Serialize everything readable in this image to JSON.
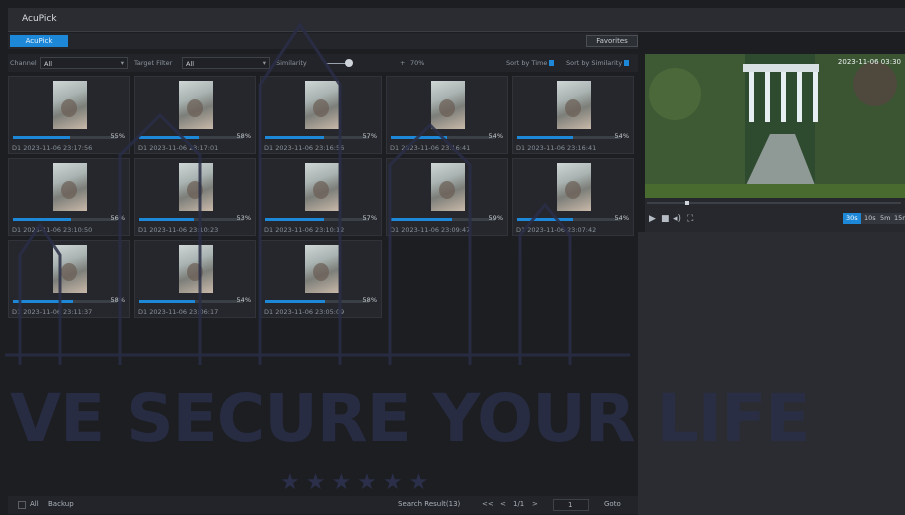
{
  "window": {
    "title": "AcuPick"
  },
  "tabs": {
    "active": "AcuPick",
    "favorites": "Favorites"
  },
  "filters": {
    "channel_label": "Channel",
    "channel_value": "All",
    "target_label": "Target Filter",
    "target_value": "All",
    "similarity_label": "Similarity",
    "threshold_label": "70%",
    "sort_time": "Sort by Time",
    "sort_similarity": "Sort by Similarity"
  },
  "results": [
    {
      "pct": "55%",
      "fill": 0.55,
      "stamp": "D1 2023-11-06 23:17:56"
    },
    {
      "pct": "58%",
      "fill": 0.58,
      "stamp": "D1 2023-11-06 23:17:01"
    },
    {
      "pct": "57%",
      "fill": 0.57,
      "stamp": "D1 2023-11-06 23:16:56"
    },
    {
      "pct": "54%",
      "fill": 0.54,
      "stamp": "D1 2023-11-06 23:16:41"
    },
    {
      "pct": "54%",
      "fill": 0.54,
      "stamp": "D1 2023-11-06 23:16:41"
    },
    {
      "pct": "56%",
      "fill": 0.56,
      "stamp": "D1 2023-11-06 23:10:50"
    },
    {
      "pct": "53%",
      "fill": 0.53,
      "stamp": "D1 2023-11-06 23:10:23"
    },
    {
      "pct": "57%",
      "fill": 0.57,
      "stamp": "D1 2023-11-06 23:10:12"
    },
    {
      "pct": "59%",
      "fill": 0.59,
      "stamp": "D1 2023-11-06 23:09:47"
    },
    {
      "pct": "54%",
      "fill": 0.54,
      "stamp": "D1 2023-11-06 23:07:42"
    },
    {
      "pct": "58%",
      "fill": 0.58,
      "stamp": "D1 2023-11-06 23:11:37"
    },
    {
      "pct": "54%",
      "fill": 0.54,
      "stamp": "D1 2023-11-06 23:06:17"
    },
    {
      "pct": "58%",
      "fill": 0.58,
      "stamp": "D1 2023-11-06 23:05:09"
    }
  ],
  "video": {
    "timestamp": "2023-11-06 03:30",
    "speeds": [
      "30s",
      "10s",
      "5m",
      "15m"
    ],
    "active_speed": "30s"
  },
  "watermark": {
    "text": "VE SECURE YOUR LIFE"
  },
  "bottom": {
    "all_label": "All",
    "backup_label": "Backup",
    "search_result": "Search Result(13)",
    "first": "<<",
    "prev": "<",
    "page": "1/1",
    "next": ">",
    "page_input": "1",
    "goto": "Goto"
  },
  "colors": {
    "accent": "#1e88d8",
    "watermark": "#2b2f49"
  }
}
